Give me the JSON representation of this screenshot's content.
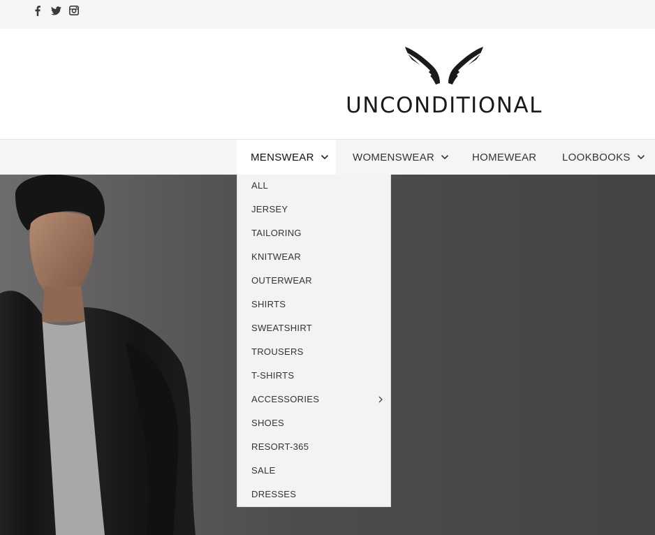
{
  "social": [
    {
      "name": "facebook-icon"
    },
    {
      "name": "twitter-icon"
    },
    {
      "name": "instagram-icon"
    }
  ],
  "logo": {
    "text": "UNCONDITIONAL"
  },
  "nav": {
    "items": [
      {
        "label": "MENSWEAR",
        "has_dropdown": true,
        "active": true
      },
      {
        "label": "WOMENSWEAR",
        "has_dropdown": true,
        "active": false
      },
      {
        "label": "HOMEWEAR",
        "has_dropdown": false,
        "active": false
      },
      {
        "label": "LOOKBOOKS",
        "has_dropdown": true,
        "active": false
      }
    ]
  },
  "dropdown": {
    "items": [
      {
        "label": "ALL"
      },
      {
        "label": "JERSEY"
      },
      {
        "label": "TAILORING"
      },
      {
        "label": "KNITWEAR"
      },
      {
        "label": "OUTERWEAR"
      },
      {
        "label": "SHIRTS"
      },
      {
        "label": "SWEATSHIRT"
      },
      {
        "label": "TROUSERS"
      },
      {
        "label": "T-SHIRTS"
      },
      {
        "label": "ACCESSORIES",
        "has_submenu": true
      },
      {
        "label": "SHOES"
      },
      {
        "label": "RESORT-365"
      },
      {
        "label": "SALE"
      },
      {
        "label": "DRESSES"
      }
    ]
  },
  "colors": {
    "topbar_bg": "#f6f5f5",
    "nav_bg": "#f6f5f5",
    "dropdown_bg": "#f4f3f3",
    "text": "#333333"
  }
}
